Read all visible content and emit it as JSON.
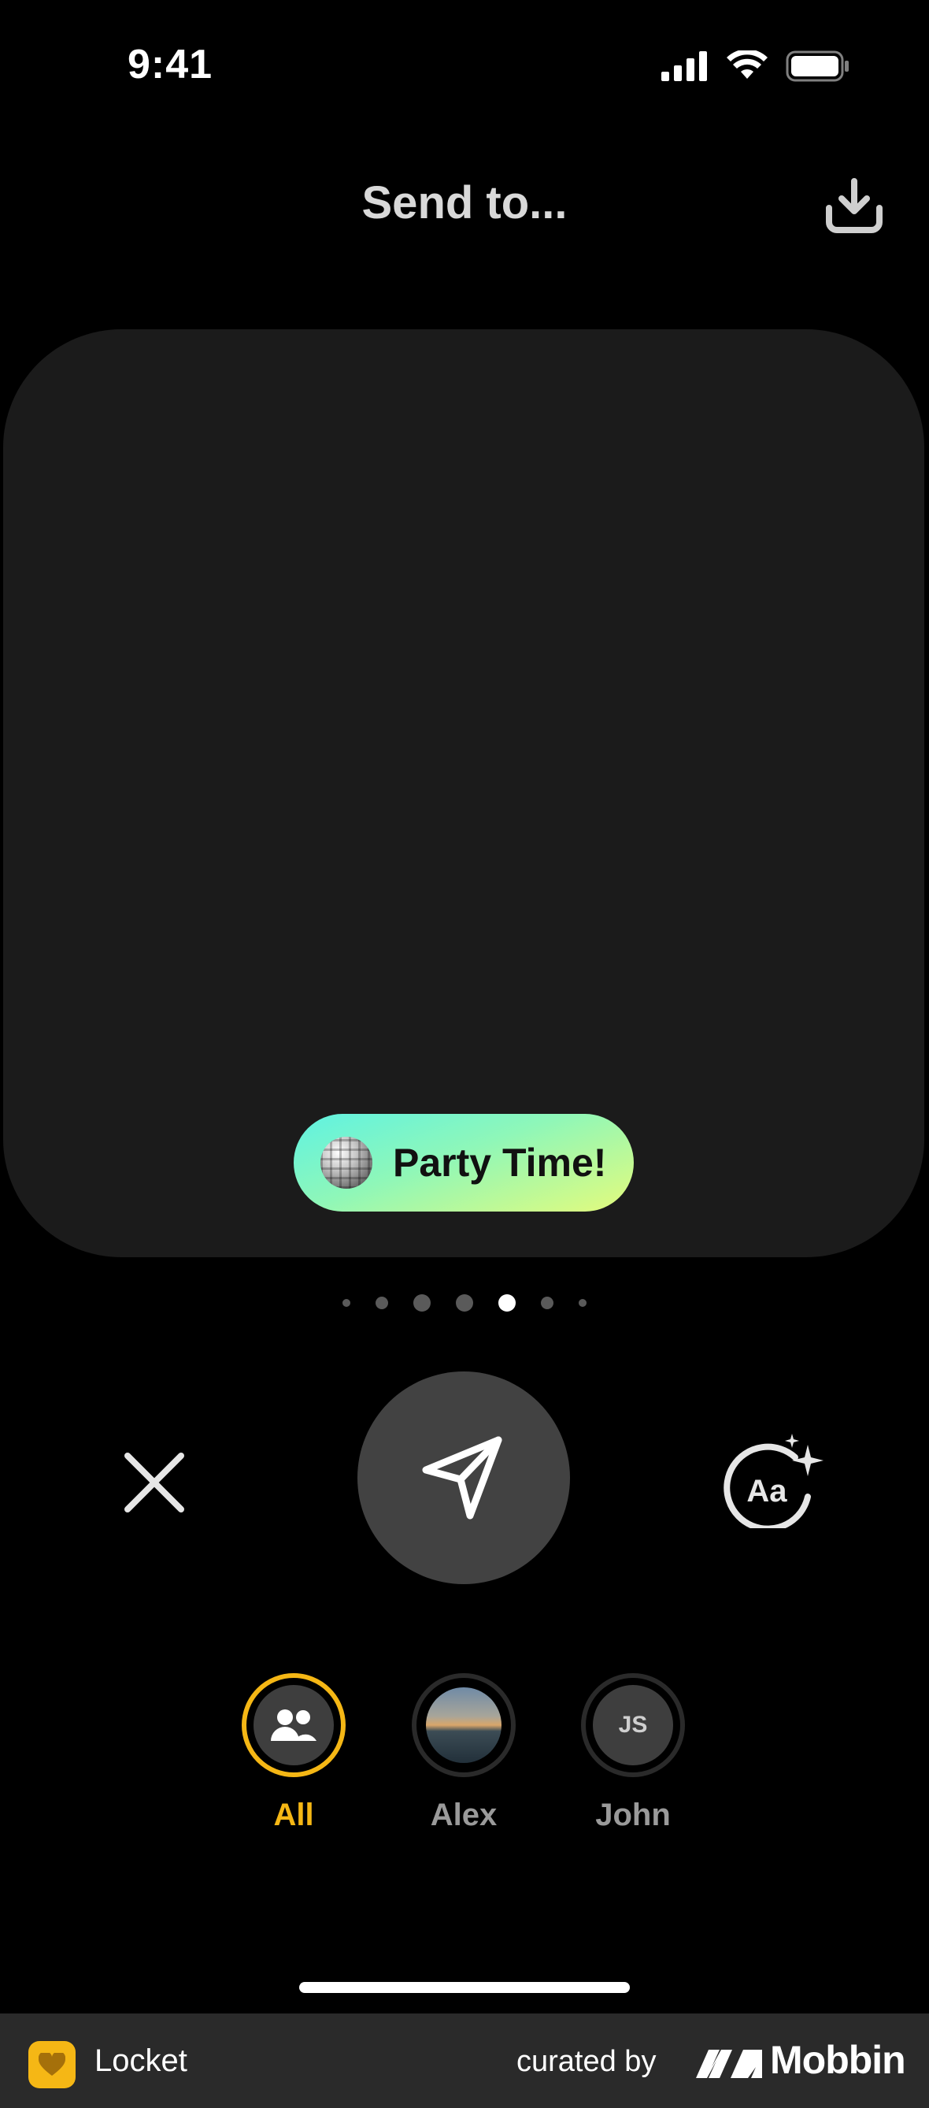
{
  "status_bar": {
    "time": "9:41"
  },
  "header": {
    "title": "Send to...",
    "download_icon": "download-icon"
  },
  "preview": {
    "caption_text": "Party Time!",
    "caption_icon": "disco-ball-emoji",
    "caption_gradient": [
      "#5ff2e2",
      "#8ff7b8",
      "#e4fb7c"
    ],
    "pages_total": 7,
    "active_page": 5
  },
  "actions": {
    "close_icon": "close-icon",
    "send_icon": "send-icon",
    "caption_style_icon": "text-style-sparkle-icon"
  },
  "recipients": [
    {
      "label": "All",
      "avatar_type": "group-icon",
      "selected": true
    },
    {
      "label": "Alex",
      "avatar_type": "photo",
      "selected": false
    },
    {
      "label": "John",
      "avatar_type": "initials",
      "initials": "JS",
      "selected": false
    }
  ],
  "colors": {
    "accent": "#f5b715",
    "background": "#000000",
    "card": "#1b1b1b",
    "send_button": "#424242",
    "muted_label": "#9a9a9a"
  },
  "footer": {
    "app_name": "Locket",
    "curated_by": "curated by",
    "brand": "Mobbin"
  }
}
